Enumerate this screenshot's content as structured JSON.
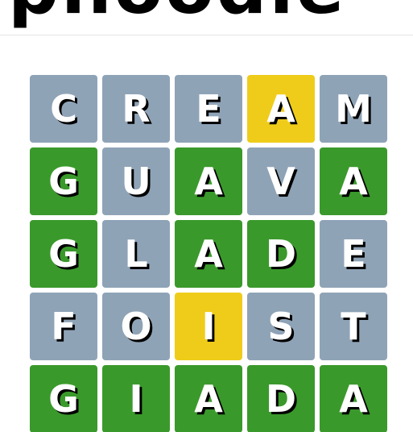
{
  "header": {
    "logo_text": "phoodle"
  },
  "colors": {
    "absent": "#8fa3b7",
    "present": "#efcc1a",
    "correct": "#3a992b"
  },
  "board": {
    "rows": [
      [
        {
          "letter": "C",
          "state": "absent"
        },
        {
          "letter": "R",
          "state": "absent"
        },
        {
          "letter": "E",
          "state": "absent"
        },
        {
          "letter": "A",
          "state": "present"
        },
        {
          "letter": "M",
          "state": "absent"
        }
      ],
      [
        {
          "letter": "G",
          "state": "correct"
        },
        {
          "letter": "U",
          "state": "absent"
        },
        {
          "letter": "A",
          "state": "correct"
        },
        {
          "letter": "V",
          "state": "absent"
        },
        {
          "letter": "A",
          "state": "correct"
        }
      ],
      [
        {
          "letter": "G",
          "state": "correct"
        },
        {
          "letter": "L",
          "state": "absent"
        },
        {
          "letter": "A",
          "state": "correct"
        },
        {
          "letter": "D",
          "state": "correct"
        },
        {
          "letter": "E",
          "state": "absent"
        }
      ],
      [
        {
          "letter": "F",
          "state": "absent"
        },
        {
          "letter": "O",
          "state": "absent"
        },
        {
          "letter": "I",
          "state": "present"
        },
        {
          "letter": "S",
          "state": "absent"
        },
        {
          "letter": "T",
          "state": "absent"
        }
      ],
      [
        {
          "letter": "G",
          "state": "correct"
        },
        {
          "letter": "I",
          "state": "correct"
        },
        {
          "letter": "A",
          "state": "correct"
        },
        {
          "letter": "D",
          "state": "correct"
        },
        {
          "letter": "A",
          "state": "correct"
        }
      ]
    ]
  }
}
